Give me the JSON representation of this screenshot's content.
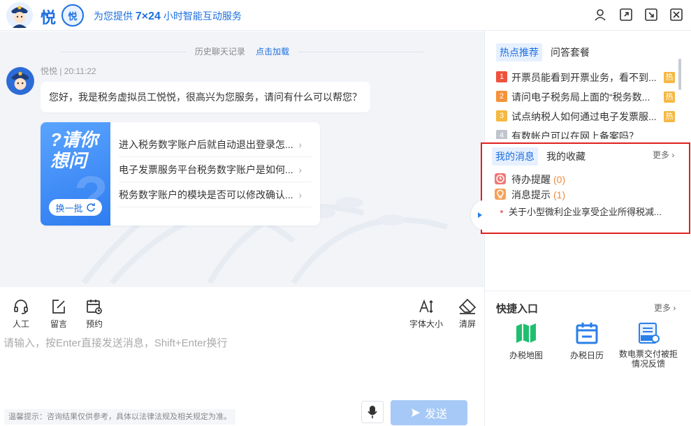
{
  "header": {
    "brand": "悦",
    "brand_badge": "悦",
    "slogan_prefix": "为您提供",
    "slogan_highlight": "7×24",
    "slogan_suffix": "小时智能互动服务",
    "icons": [
      "user-icon",
      "expand-icon",
      "minimize-icon",
      "close-icon"
    ]
  },
  "chat": {
    "history_label": "历史聊天记录",
    "load_more": "点击加载",
    "bot_name_time": "悦悦 | 20:11:22",
    "greeting": "您好，我是税务虚拟员工悦悦，很高兴为您服务，请问有什么可以帮您？",
    "ask_card": {
      "title": "?请你想问",
      "swap_label": "换一批",
      "questions": [
        "进入税务数字账户后就自动退出登录怎...",
        "电子发票服务平台税务数字账户是如何...",
        "税务数字账户的模块是否可以修改确认..."
      ]
    }
  },
  "toolbar": {
    "left": [
      {
        "label": "人工",
        "icon": "headset-icon"
      },
      {
        "label": "留言",
        "icon": "edit-icon"
      },
      {
        "label": "预约",
        "icon": "calendar-clock-icon"
      }
    ],
    "right": [
      {
        "label": "字体大小",
        "icon": "font-size-icon"
      },
      {
        "label": "清屏",
        "icon": "eraser-icon"
      }
    ]
  },
  "input": {
    "placeholder": "请输入，按Enter直接发送消息，Shift+Enter换行",
    "hint": "温馨提示：咨询结果仅供参考，具体以法律法规及相关规定为准。",
    "send_label": "发送"
  },
  "right_panel": {
    "tabs_top": [
      "热点推荐",
      "问答套餐"
    ],
    "hot_list": [
      {
        "rank": "1",
        "text": "开票员能看到开票业务，看不到...",
        "badge": "热",
        "color": "#f0513c"
      },
      {
        "rank": "2",
        "text": "请问电子税务局上面的“税务数...",
        "badge": "热",
        "color": "#f5923a"
      },
      {
        "rank": "3",
        "text": "试点纳税人如何通过电子发票服...",
        "badge": "热",
        "color": "#f6b840"
      },
      {
        "rank": "4",
        "text": "有数帐户可以在网上备案吗？",
        "badge": "",
        "color": "#c0c4cc"
      }
    ],
    "tabs_msg": [
      "我的消息",
      "我的收藏"
    ],
    "more_label": "更多",
    "messages": [
      {
        "label": "待办提醒",
        "count": "(0)",
        "icon": "clock-icon",
        "color": "#f07878"
      },
      {
        "label": "消息提示",
        "count": "(1)",
        "icon": "bulb-icon",
        "color": "#f5a25a"
      }
    ],
    "message_item": "关于小型微利企业享受企业所得税减...",
    "quick_title": "快捷入口",
    "quick_more": "更多",
    "quick_links": [
      {
        "label": "办税地图",
        "icon": "map-icon",
        "color": "#1fbf6f"
      },
      {
        "label": "办税日历",
        "icon": "calendar-icon",
        "color": "#2a7fe8"
      },
      {
        "label": "数电票交付被拒情况反馈",
        "icon": "invoice-icon",
        "color": "#2a7fe8"
      }
    ]
  }
}
